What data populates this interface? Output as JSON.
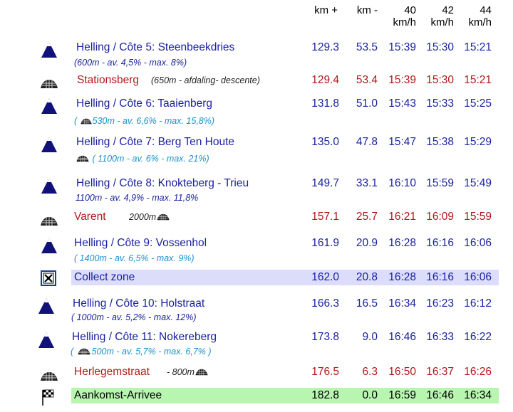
{
  "header": {
    "km_plus": "km +",
    "km_minus": "km -",
    "speed40": "40",
    "speed42": "42",
    "speed44": "44",
    "unit": "km/h"
  },
  "rows": [
    {
      "name": "Helling / Côte 5: Steenbeekdries",
      "sub": "(600m - av. 4,5% - max. 8%)",
      "km": "129.3",
      "kmm": "53.5",
      "t40": "15:39",
      "t42": "15:30",
      "t44": "15:21"
    },
    {
      "name": "Stationsberg",
      "sub": "(650m - afdaling- descente)",
      "km": "129.4",
      "kmm": "53.4",
      "t40": "15:39",
      "t42": "15:30",
      "t44": "15:21"
    },
    {
      "name": "Helling / Côte 6: Taaienberg",
      "sub_pre": "(",
      "sub": "530m - av. 6,6% - max. 15,8%)",
      "km": "131.8",
      "kmm": "51.0",
      "t40": "15:43",
      "t42": "15:33",
      "t44": "15:25"
    },
    {
      "name": "Helling / Côte 7: Berg Ten Houte",
      "sub": "( 1100m - av. 6% - max. 21%)",
      "km": "135.0",
      "kmm": "47.8",
      "t40": "15:47",
      "t42": "15:38",
      "t44": "15:29"
    },
    {
      "name": "Helling / Côte 8: Knokteberg - Trieu",
      "sub": "1100m - av. 4,9% - max. 11,8%",
      "km": "149.7",
      "kmm": "33.1",
      "t40": "16:10",
      "t42": "15:59",
      "t44": "15:49"
    },
    {
      "name": "Varent",
      "sub": "2000m",
      "km": "157.1",
      "kmm": "25.7",
      "t40": "16:21",
      "t42": "16:09",
      "t44": "15:59"
    },
    {
      "name": "Helling / Côte 9: Vossenhol",
      "sub": "( 1400m - av. 6,5% - max. 9%)",
      "km": "161.9",
      "kmm": "20.9",
      "t40": "16:28",
      "t42": "16:16",
      "t44": "16:06"
    },
    {
      "name": "Collect zone",
      "km": "162.0",
      "kmm": "20.8",
      "t40": "16:28",
      "t42": "16:16",
      "t44": "16:06"
    },
    {
      "name": "Helling / Côte 10: Holstraat",
      "sub": "( 1000m - av. 5,2% - max. 12%)",
      "km": "166.3",
      "kmm": "16.5",
      "t40": "16:34",
      "t42": "16:23",
      "t44": "16:12"
    },
    {
      "name": "Helling / Côte 11: Nokereberg",
      "sub_pre": "(",
      "sub": "500m - av. 5,7% - max. 6,7% )",
      "km": "173.8",
      "kmm": "9.0",
      "t40": "16:46",
      "t42": "16:33",
      "t44": "16:22"
    },
    {
      "name": "Herlegemstraat",
      "sub": "- 800m",
      "km": "176.5",
      "kmm": "6.3",
      "t40": "16:50",
      "t42": "16:37",
      "t44": "16:26"
    },
    {
      "name": "Aankomst-Arrivee",
      "km": "182.8",
      "kmm": "0.0",
      "t40": "16:59",
      "t42": "16:46",
      "t44": "16:34"
    }
  ]
}
